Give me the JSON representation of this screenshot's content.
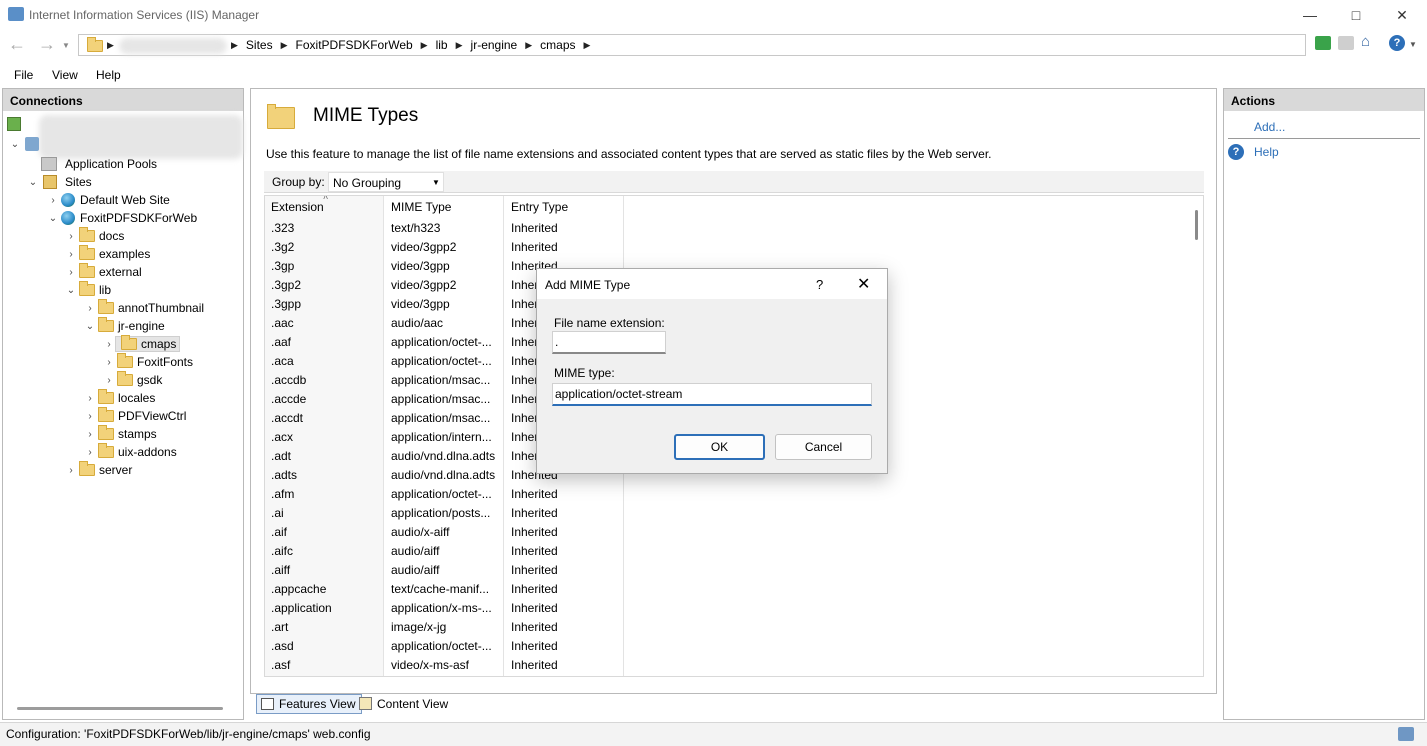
{
  "window": {
    "title": "Internet Information Services (IIS) Manager"
  },
  "address": {
    "crumbs": [
      "Sites",
      "FoxitPDFSDKForWeb",
      "lib",
      "jr-engine",
      "cmaps"
    ]
  },
  "menu": [
    "File",
    "View",
    "Help"
  ],
  "connections": {
    "header": "Connections",
    "tree": [
      {
        "label": "Application Pools"
      },
      {
        "label": "Sites"
      },
      {
        "label": "Default Web Site"
      },
      {
        "label": "FoxitPDFSDKForWeb"
      },
      {
        "label": "docs"
      },
      {
        "label": "examples"
      },
      {
        "label": "external"
      },
      {
        "label": "lib"
      },
      {
        "label": "annotThumbnail"
      },
      {
        "label": "jr-engine"
      },
      {
        "label": "cmaps"
      },
      {
        "label": "FoxitFonts"
      },
      {
        "label": "gsdk"
      },
      {
        "label": "locales"
      },
      {
        "label": "PDFViewCtrl"
      },
      {
        "label": "stamps"
      },
      {
        "label": "uix-addons"
      },
      {
        "label": "server"
      }
    ]
  },
  "main": {
    "title": "MIME Types",
    "description": "Use this feature to manage the list of file name extensions and associated content types that are served as static files by the Web server.",
    "group_by_label": "Group by:",
    "group_by_value": "No Grouping",
    "columns": [
      "Extension",
      "MIME Type",
      "Entry Type"
    ],
    "rows": [
      [
        ".323",
        "text/h323",
        "Inherited"
      ],
      [
        ".3g2",
        "video/3gpp2",
        "Inherited"
      ],
      [
        ".3gp",
        "video/3gpp",
        "Inherited"
      ],
      [
        ".3gp2",
        "video/3gpp2",
        "Inher"
      ],
      [
        ".3gpp",
        "video/3gpp",
        "Inher"
      ],
      [
        ".aac",
        "audio/aac",
        "Inher"
      ],
      [
        ".aaf",
        "application/octet-...",
        "Inher"
      ],
      [
        ".aca",
        "application/octet-...",
        "Inher"
      ],
      [
        ".accdb",
        "application/msac...",
        "Inher"
      ],
      [
        ".accde",
        "application/msac...",
        "Inher"
      ],
      [
        ".accdt",
        "application/msac...",
        "Inher"
      ],
      [
        ".acx",
        "application/intern...",
        "Inher"
      ],
      [
        ".adt",
        "audio/vnd.dlna.adts",
        "Inher"
      ],
      [
        ".adts",
        "audio/vnd.dlna.adts",
        "Inherited"
      ],
      [
        ".afm",
        "application/octet-...",
        "Inherited"
      ],
      [
        ".ai",
        "application/posts...",
        "Inherited"
      ],
      [
        ".aif",
        "audio/x-aiff",
        "Inherited"
      ],
      [
        ".aifc",
        "audio/aiff",
        "Inherited"
      ],
      [
        ".aiff",
        "audio/aiff",
        "Inherited"
      ],
      [
        ".appcache",
        "text/cache-manif...",
        "Inherited"
      ],
      [
        ".application",
        "application/x-ms-...",
        "Inherited"
      ],
      [
        ".art",
        "image/x-jg",
        "Inherited"
      ],
      [
        ".asd",
        "application/octet-...",
        "Inherited"
      ],
      [
        ".asf",
        "video/x-ms-asf",
        "Inherited"
      ]
    ],
    "features_view": "Features View",
    "content_view": "Content View"
  },
  "actions": {
    "header": "Actions",
    "add": "Add...",
    "help": "Help"
  },
  "dialog": {
    "title": "Add MIME Type",
    "help_glyph": "?",
    "ext_label": "File name extension:",
    "ext_value": ".",
    "mime_label": "MIME type:",
    "mime_value": "application/octet-stream",
    "ok": "OK",
    "cancel": "Cancel"
  },
  "status": {
    "text": "Configuration: 'FoxitPDFSDKForWeb/lib/jr-engine/cmaps' web.config"
  }
}
